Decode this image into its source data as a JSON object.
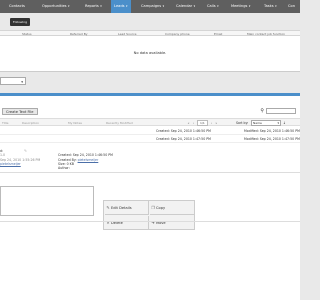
{
  "nav": {
    "items": [
      {
        "label": "Contacts",
        "active": false
      },
      {
        "label": "Opportunities",
        "active": false,
        "caret": true
      },
      {
        "label": "Reports",
        "active": false,
        "caret": true
      },
      {
        "label": "Leads",
        "active": true,
        "caret": true
      },
      {
        "label": "Campaigns",
        "active": false,
        "caret": true
      },
      {
        "label": "Calendar",
        "active": false,
        "caret": true
      },
      {
        "label": "Calls",
        "active": false,
        "caret": true
      },
      {
        "label": "Meetings",
        "active": false,
        "caret": true
      },
      {
        "label": "Tasks",
        "active": false,
        "caret": true
      },
      {
        "label": "Con",
        "active": false
      }
    ]
  },
  "tooltip": "Following",
  "list_header": {
    "columns": [
      "Status",
      "Referred By",
      "Lead Source",
      "Company phone",
      "Email",
      "Main contact job function"
    ]
  },
  "empty_message": "No data available.",
  "documents": {
    "create_button": "Create Text File",
    "columns": [
      "Title",
      "Description",
      "My Notes",
      "Recently Modified"
    ],
    "pager": {
      "prev_first": "«",
      "prev": "‹",
      "info": "1/1",
      "next": "›",
      "next_last": "»"
    },
    "sort_label": "Sort by:",
    "sort_value": "Name",
    "sort_dir": "↓",
    "rows": [
      {
        "created": "Created: Sep 24, 2010 1:46:50 PM",
        "modified": "Modified: Sep 24, 2010 1:46:50 PM"
      },
      {
        "created": "Created: Sep 24, 2010 1:47:50 PM",
        "modified": "Modified: Sep 24, 2010 1:47:50 PM"
      }
    ]
  },
  "details": {
    "title_tail": "d:",
    "version": "1.0",
    "date_modified": "Sep 24, 2010 1:55:26 PM",
    "modified_by": "pietelsmeijer",
    "created": "Created: Sep 24, 2010 1:46:50 PM",
    "created_by_label": "Created By:",
    "created_by": "pietelsmeijer",
    "size": "Size: 0 KB",
    "author_label": "Author:"
  },
  "actions": {
    "edit": "Edit Details",
    "copy": "Copy",
    "delete": "Delete",
    "move": "Move"
  },
  "colors": {
    "nav_bg": "#5f5f5f",
    "accent": "#4b8fca"
  }
}
